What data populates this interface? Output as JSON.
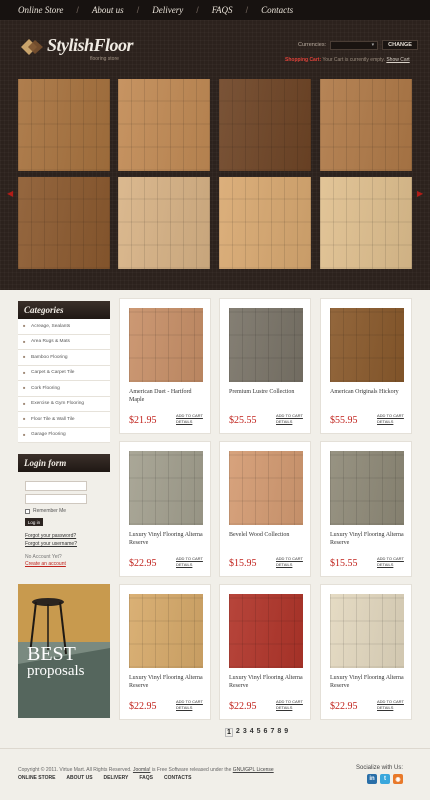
{
  "nav": {
    "items": [
      "Online Store",
      "About us",
      "Delivery",
      "FAQS",
      "Contacts"
    ]
  },
  "logo": {
    "title": "StylishFloor",
    "subtitle": "flooring store"
  },
  "header": {
    "currencies_label": "Currencies:",
    "currency_value": "",
    "change_label": "CHANGE",
    "cart_label": "Shopping Cart:",
    "cart_status": "Your Cart is currently empty.",
    "show_cart": "Show Cart"
  },
  "slider": {
    "tile_colors": [
      "#a8733f",
      "#c28b55",
      "#6f4526",
      "#b07a48",
      "#8c5a2f",
      "#d8b386",
      "#d9a971",
      "#e0c08f"
    ]
  },
  "sidebar": {
    "categories_title": "Categories",
    "categories": [
      "Acreage, Sealants",
      "Area Rugs & Mats",
      "Bamboo Flooring",
      "Carpet & Carpet Tile",
      "Cork Flooring",
      "Exercise & Gym Flooring",
      "Floor Tile & Wall Tile",
      "Garage Flooring"
    ],
    "login_title": "Login form",
    "remember": "Remember Me",
    "login_button": "Log in",
    "forgot_password": "Forgot your password?",
    "forgot_username": "Forgot your username?",
    "no_account": "No Account Yet?",
    "create_account": "Create an account"
  },
  "promo": {
    "big": "BEST",
    "small": "proposals"
  },
  "products": [
    {
      "name": "American Duet - Hartford Maple",
      "price": "$21.95",
      "add": "ADD TO CART",
      "details": "DETAILS",
      "color": "#c89068"
    },
    {
      "name": "Premium Lustre Collection",
      "price": "$25.55",
      "add": "ADD TO CART",
      "details": "DETAILS",
      "color": "#7a7468"
    },
    {
      "name": "American Originals Hickory",
      "price": "$55.95",
      "add": "ADD TO CART",
      "details": "DETAILS",
      "color": "#8a5a2c"
    },
    {
      "name": "Luxury Vinyl Flooring Alterna Reserve",
      "price": "$22.95",
      "add": "ADD TO CART",
      "details": "DETAILS",
      "color": "#a3a08f"
    },
    {
      "name": "Bevelel Wood Collection",
      "price": "$15.95",
      "add": "ADD TO CART",
      "details": "DETAILS",
      "color": "#d49b72"
    },
    {
      "name": "Luxury Vinyl Flooring Alterna Reserve",
      "price": "$15.55",
      "add": "ADD TO CART",
      "details": "DETAILS",
      "color": "#8f8a78"
    },
    {
      "name": "Luxury Vinyl Flooring Alterna Reserve",
      "price": "$22.95",
      "add": "ADD TO CART",
      "details": "DETAILS",
      "color": "#d7aa6a"
    },
    {
      "name": "Luxury Vinyl Flooring Alterna Reserve",
      "price": "$22.95",
      "add": "ADD TO CART",
      "details": "DETAILS",
      "color": "#b1352a"
    },
    {
      "name": "Luxury Vinyl Flooring Alterna Reserve",
      "price": "$22.95",
      "add": "ADD TO CART",
      "details": "DETAILS",
      "color": "#e3d8bf"
    }
  ],
  "pagination": [
    "1",
    "2",
    "3",
    "4",
    "5",
    "6",
    "7",
    "8",
    "9"
  ],
  "footer": {
    "copyright_pre": "Copyright © 2011. Virtue Mart. All Rights Reserved.",
    "joomla": "Joomla!",
    "copyright_mid": "is Free Software released under the",
    "license": "GNU/GPL License",
    "nav": [
      "ONLINE STORE",
      "ABOUT US",
      "DELIVERY",
      "FAQS",
      "CONTACTS"
    ],
    "socialize": "Socialize with Us:",
    "icons": [
      "linkedin-icon",
      "twitter-icon",
      "rss-icon"
    ]
  },
  "colors": {
    "accent": "#c0211b",
    "dark": "#2c221d"
  }
}
